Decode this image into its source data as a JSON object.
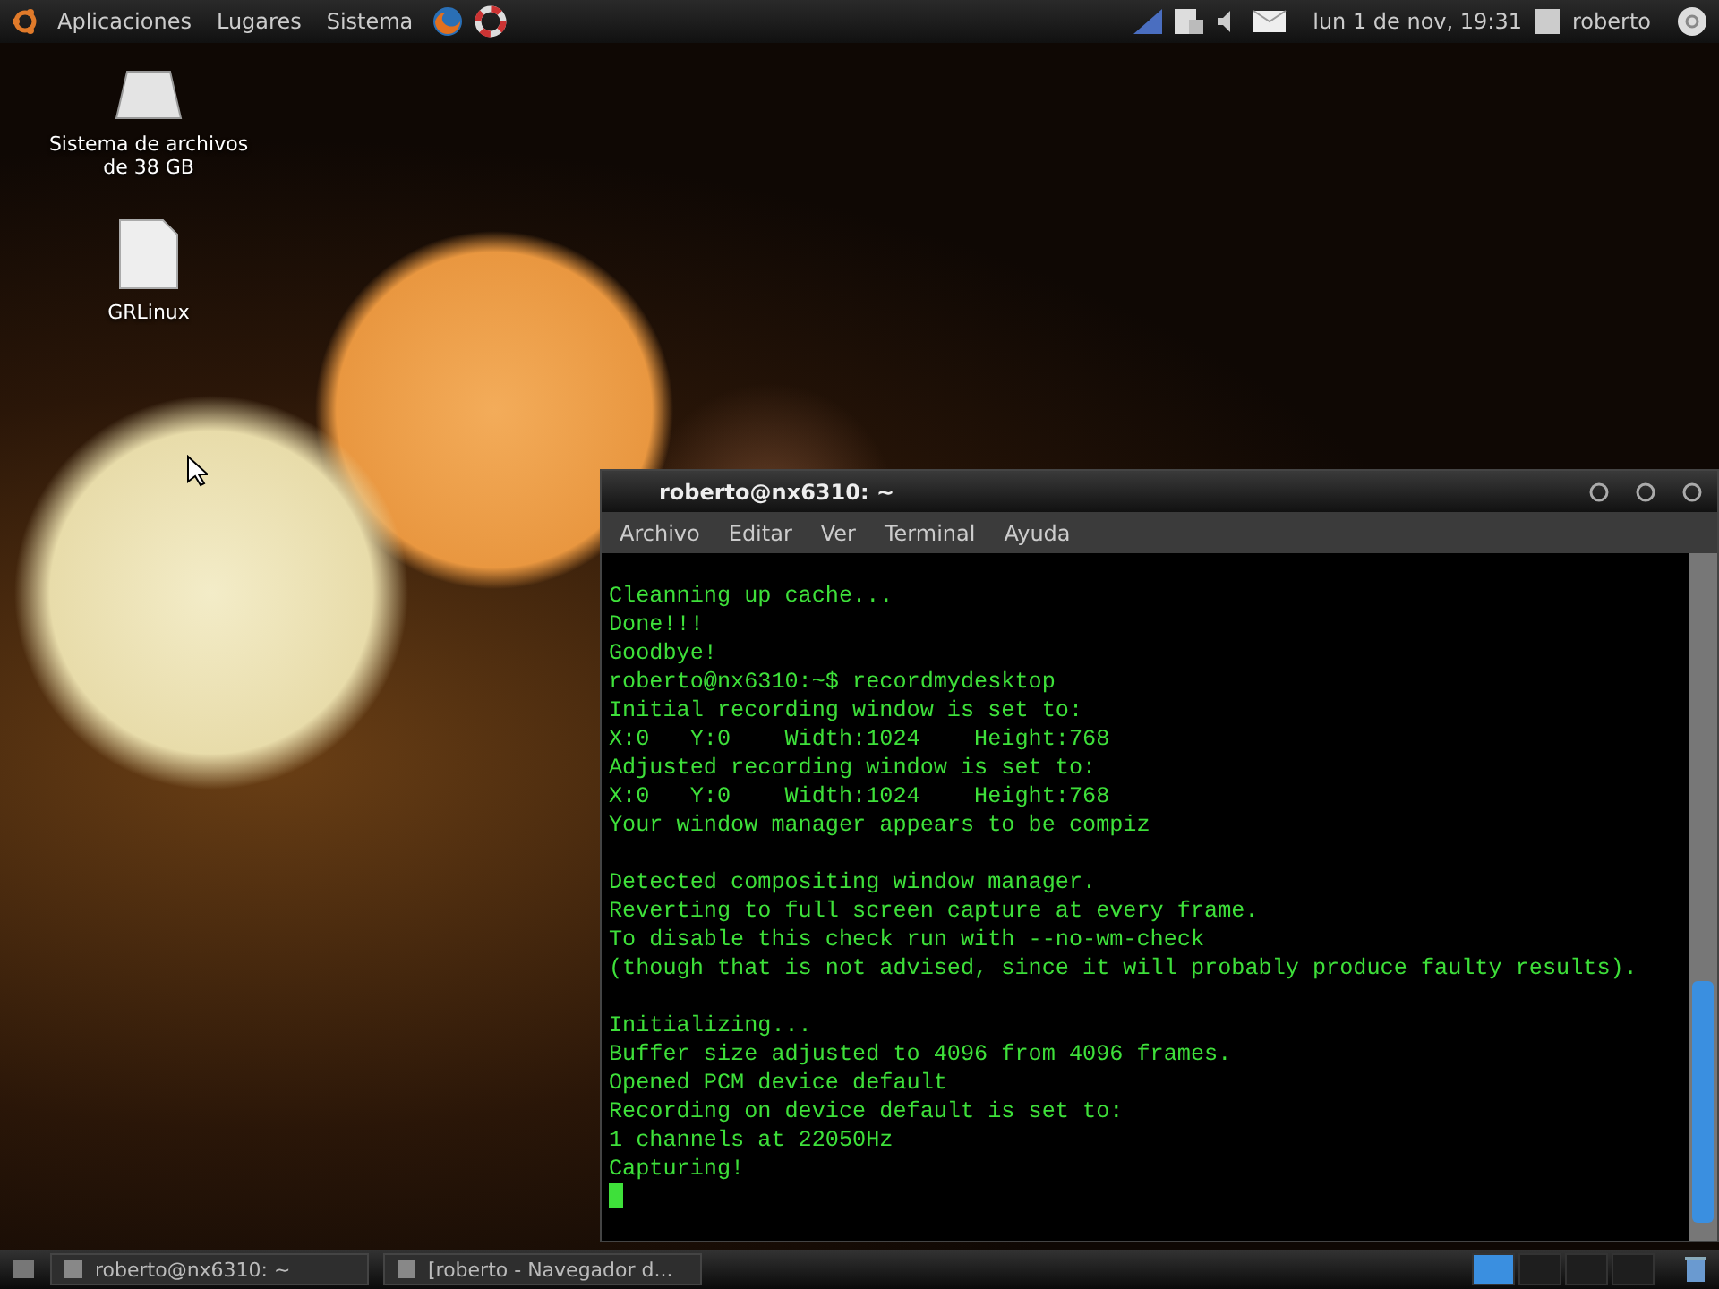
{
  "top_panel": {
    "menus": [
      "Aplicaciones",
      "Lugares",
      "Sistema"
    ],
    "clock": "lun 1 de nov, 19:31",
    "user": "roberto"
  },
  "desktop_icons": [
    {
      "label": "Sistema de archivos de 38 GB",
      "kind": "drive"
    },
    {
      "label": "GRLinux",
      "kind": "file"
    }
  ],
  "terminal": {
    "title": "roberto@nx6310: ~",
    "menu": [
      "Archivo",
      "Editar",
      "Ver",
      "Terminal",
      "Ayuda"
    ],
    "blocks": [
      [
        "Cleanning up cache...",
        "Done!!!",
        "Goodbye!",
        "roberto@nx6310:~$ recordmydesktop",
        "Initial recording window is set to:",
        "X:0   Y:0    Width:1024    Height:768",
        "Adjusted recording window is set to:",
        "X:0   Y:0    Width:1024    Height:768",
        "Your window manager appears to be compiz"
      ],
      [
        "Detected compositing window manager.",
        "Reverting to full screen capture at every frame.",
        "To disable this check run with --no-wm-check",
        "(though that is not advised, since it will probably produce faulty results)."
      ],
      [
        "Initializing...",
        "Buffer size adjusted to 4096 from 4096 frames.",
        "Opened PCM device default",
        "Recording on device default is set to:",
        "1 channels at 22050Hz",
        "Capturing!"
      ]
    ]
  },
  "taskbar": {
    "items": [
      "roberto@nx6310: ~",
      "[roberto - Navegador d..."
    ],
    "workspaces": [
      {
        "selected": true
      },
      {
        "selected": false
      },
      {
        "selected": false
      },
      {
        "selected": false
      }
    ]
  }
}
